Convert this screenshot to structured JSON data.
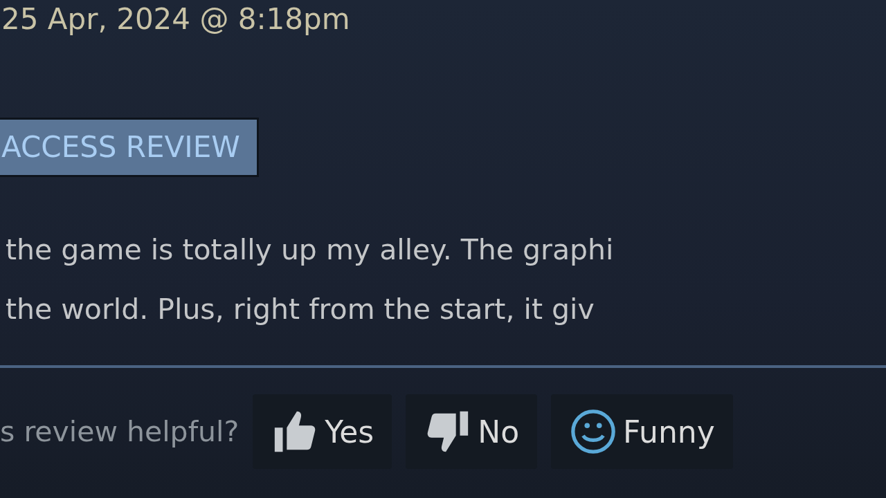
{
  "review": {
    "date": "25 Apr, 2024 @ 8:18pm",
    "badge": "ACCESS REVIEW",
    "lines": [
      "the game is totally up my alley. The graphi",
      "the world. Plus, right from the start, it giv"
    ]
  },
  "feedback": {
    "question": "s review helpful?",
    "buttons": [
      {
        "kind": "up",
        "label": "Yes"
      },
      {
        "kind": "down",
        "label": "No"
      },
      {
        "kind": "funny",
        "label": "Funny"
      }
    ]
  }
}
